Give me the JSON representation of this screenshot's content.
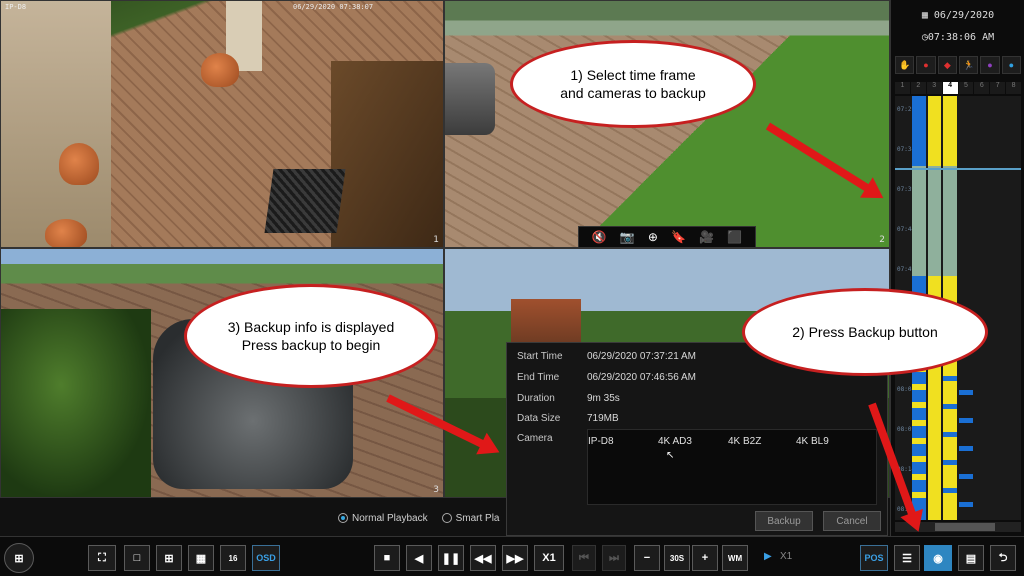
{
  "cameras": [
    {
      "num": "1",
      "osd_name": "IP-D8",
      "osd_time": "06/29/2020 07:38:07"
    },
    {
      "num": "2"
    },
    {
      "num": "3"
    },
    {
      "num": "4"
    }
  ],
  "camera_toolbar": {
    "icons": [
      "mute-icon",
      "snapshot-icon",
      "zoom-icon",
      "bookmark-icon",
      "record-clip-icon",
      "backup-icon"
    ]
  },
  "backup_info": {
    "start_time_label": "Start Time",
    "start_time": "06/29/2020 07:37:21 AM",
    "end_time_label": "End Time",
    "end_time": "06/29/2020 07:46:56 AM",
    "duration_label": "Duration",
    "duration": "9m 35s",
    "data_size_label": "Data Size",
    "data_size": "719MB",
    "camera_label": "Camera",
    "camera_list": [
      "IP-D8",
      "4K AD3",
      "4K B2Z",
      "4K BL9"
    ],
    "backup_button": "Backup",
    "cancel_button": "Cancel"
  },
  "playback_mode": {
    "normal": "Normal Playback",
    "smart": "Smart Pla",
    "selected": "normal"
  },
  "timeline": {
    "date": "06/29/2020",
    "time": "07:38:06 AM",
    "channels": [
      "1",
      "2",
      "3",
      "4",
      "5",
      "6",
      "7",
      "8"
    ],
    "active_channel": "4",
    "ticks": [
      "07:29",
      "07:34",
      "07:39",
      "07:44",
      "07:49",
      "07:54",
      "07:59",
      "08:04",
      "08:09",
      "08:14",
      "08:19"
    ],
    "colors": {
      "motion": "#f0e020",
      "normal": "#1a6fd4",
      "selected": "#8fb09c"
    }
  },
  "toolbar": {
    "osd": "OSD",
    "speed": "X1",
    "interval": "30S",
    "wm": "WM",
    "play_speed": "X1",
    "pos": "POS"
  },
  "annotations": {
    "step1": [
      "1) Select time frame",
      "and cameras to backup"
    ],
    "step2": [
      "2) Press Backup button"
    ],
    "step3": [
      "3) Backup info is displayed",
      "Press backup to begin"
    ]
  },
  "accent_color": "#2e86c1"
}
